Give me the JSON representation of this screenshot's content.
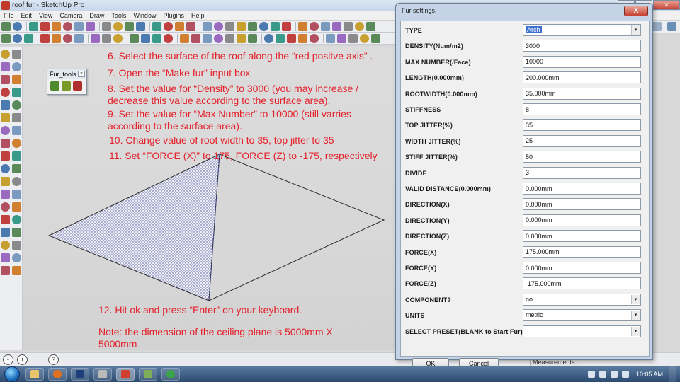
{
  "window": {
    "title": "roof fur - SketchUp Pro"
  },
  "menu": [
    "File",
    "Edit",
    "View",
    "Camera",
    "Draw",
    "Tools",
    "Window",
    "Plugins",
    "Help"
  ],
  "colors": {
    "instruction_text": "#e4202a",
    "selection_blue": "#3d6fcc",
    "dialog_frame": "#c4d4e6"
  },
  "instructions": [
    {
      "text": "6. Select the surface of the roof along the “red positve axis” ."
    },
    {
      "text": "7. Open the “Make fur” input box"
    },
    {
      "text": "8. Set the value for “Density” to 3000 (you may increase /\ndecrease this value according to the surface area)."
    },
    {
      "text": "9. Set the value for “Max Number” to 10000 (still varries\naccording to the surface area)."
    },
    {
      "text": "10. Change value of root width to 35, top jitter to 35"
    },
    {
      "text": "11. Set “FORCE (X)” to 175, FORCE (Z) to -175, respectively"
    },
    {
      "text": "12. Hit ok and press “Enter” on your keyboard."
    },
    {
      "text": "Note: the dimension of the ceiling plane is 5000mm X\n5000mm"
    }
  ],
  "fur_tools": {
    "title": "Fur_tools",
    "close": "×"
  },
  "dialog": {
    "title": "Fur settings.",
    "close": "X",
    "fields": [
      {
        "label": "TYPE",
        "value": "Arch",
        "kind": "select",
        "selected": true
      },
      {
        "label": "DENSITY(Num/m2)",
        "value": "3000",
        "kind": "text"
      },
      {
        "label": "MAX NUMBER(/Face)",
        "value": "10000",
        "kind": "text"
      },
      {
        "label": "LENGTH(0.000mm)",
        "value": "200.000mm",
        "kind": "text"
      },
      {
        "label": "ROOTWIDTH(0.000mm)",
        "value": "35.000mm",
        "kind": "text"
      },
      {
        "label": "STIFFNESS",
        "value": "8",
        "kind": "text"
      },
      {
        "label": "TOP JITTER(%)",
        "value": "35",
        "kind": "text"
      },
      {
        "label": "WIDTH JITTER(%)",
        "value": "25",
        "kind": "text"
      },
      {
        "label": "STIFF JITTER(%)",
        "value": "50",
        "kind": "text"
      },
      {
        "label": "DIVIDE",
        "value": "3",
        "kind": "text"
      },
      {
        "label": "VALID DISTANCE(0.000mm)",
        "value": "0.000mm",
        "kind": "text"
      },
      {
        "label": "DIRECTION(X)",
        "value": "0.000mm",
        "kind": "text"
      },
      {
        "label": "DIRECTION(Y)",
        "value": "0.000mm",
        "kind": "text"
      },
      {
        "label": "DIRECTION(Z)",
        "value": "0.000mm",
        "kind": "text"
      },
      {
        "label": "FORCE(X)",
        "value": "175.000mm",
        "kind": "text"
      },
      {
        "label": "FORCE(Y)",
        "value": "0.000mm",
        "kind": "text"
      },
      {
        "label": "FORCE(Z)",
        "value": "-175.000mm",
        "kind": "text"
      },
      {
        "label": "COMPONENT?",
        "value": "no",
        "kind": "select"
      },
      {
        "label": "UNITS",
        "value": "metric",
        "kind": "select"
      },
      {
        "label": "SELECT PRESET(BLANK to Start Fur)",
        "value": "",
        "kind": "select"
      }
    ],
    "ok_label": "OK",
    "cancel_label": "Cancel"
  },
  "measurements_label": "Measurements",
  "status": {
    "help_icon": "?"
  },
  "taskbar": {
    "clock": "10:05 AM"
  }
}
